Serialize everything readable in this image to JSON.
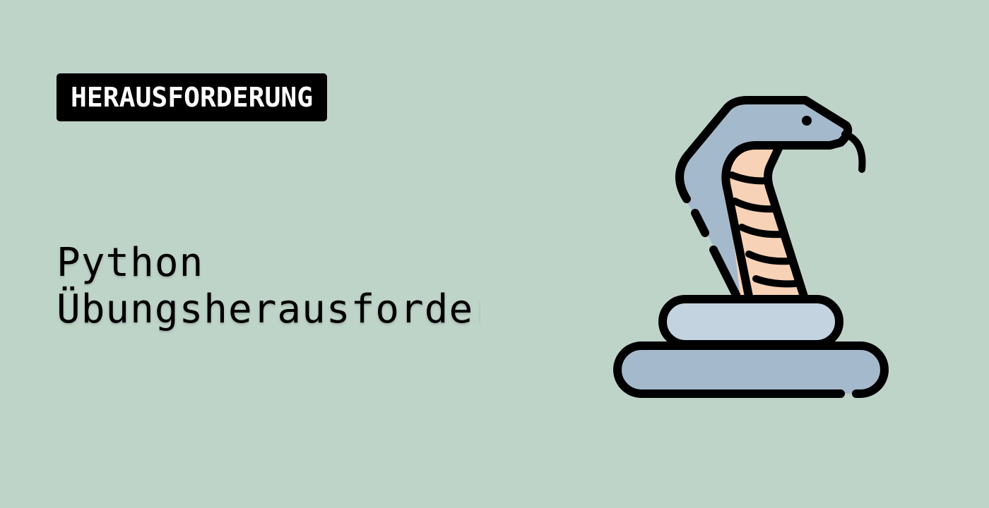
{
  "badge": {
    "label": "HERAUSFORDERUNG"
  },
  "title": {
    "line1": "Python",
    "line2": "Übungsherausforderung"
  },
  "illustration": {
    "icon": "cobra-snake-icon",
    "colors": {
      "outline": "#000000",
      "body": "#a5b9cc",
      "coil_light": "#c3d3e0",
      "belly": "#f7d2b6",
      "background": "#bfd4c9"
    }
  }
}
